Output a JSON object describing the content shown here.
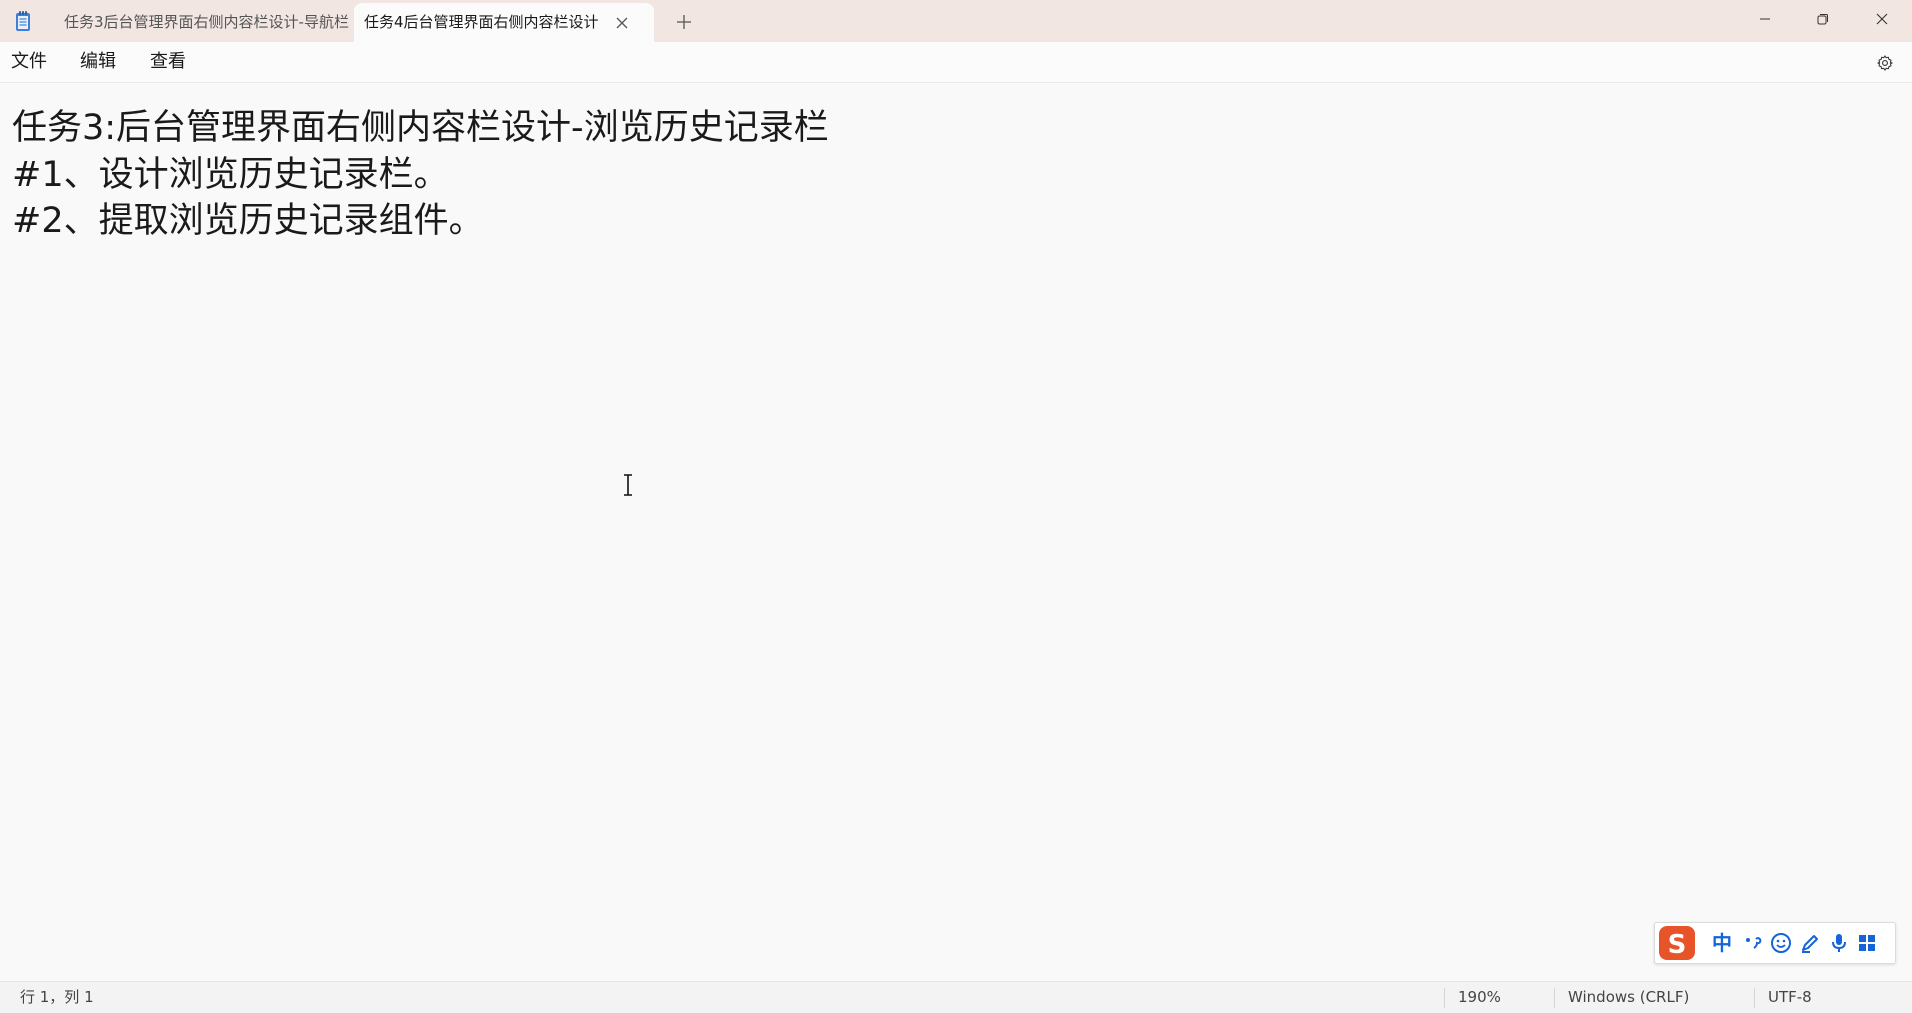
{
  "tabs": [
    {
      "label": "任务3后台管理界面右侧内容栏设计-导航栏",
      "active": false
    },
    {
      "label": "任务4后台管理界面右侧内容栏设计",
      "active": true
    }
  ],
  "menu": {
    "file": "文件",
    "edit": "编辑",
    "view": "查看"
  },
  "editor": {
    "lines": [
      "任务3:后台管理界面右侧内容栏设计-浏览历史记录栏",
      "#1、设计浏览历史记录栏。",
      "#2、提取浏览历史记录组件。"
    ]
  },
  "ime": {
    "mode_label": "中",
    "accent_color": "#e8542a",
    "icon_color": "#1564d8"
  },
  "status": {
    "position": "行 1，列 1",
    "zoom": "190%",
    "line_ending": "Windows (CRLF)",
    "encoding": "UTF-8"
  }
}
